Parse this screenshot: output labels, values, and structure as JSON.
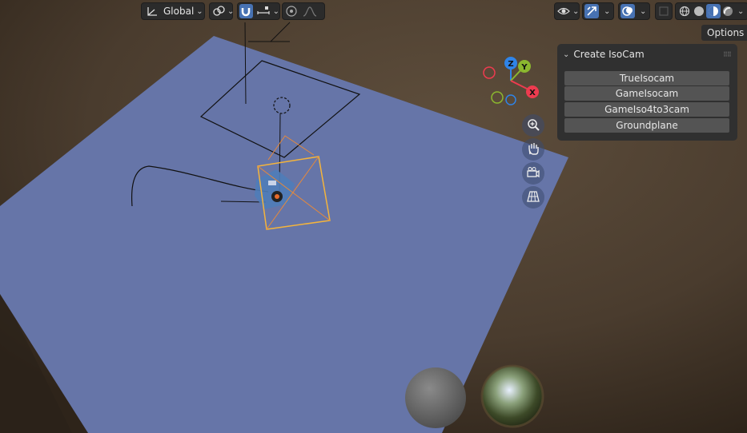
{
  "header": {
    "orientation": {
      "label": "Global"
    },
    "options_label": "Options"
  },
  "panel": {
    "title": "Create IsoCam",
    "buttons": [
      {
        "label": "TrueIsocam"
      },
      {
        "label": "GameIsocam"
      },
      {
        "label": "GameIso4to3cam"
      },
      {
        "label": "Groundplane"
      }
    ]
  },
  "gizmo": {
    "axes": {
      "z": "Z",
      "y": "Y",
      "x": "X"
    },
    "colors": {
      "x": "#ee3b4f",
      "y": "#8bb72f",
      "z": "#2f84e8"
    }
  },
  "nav_icons": [
    "zoom-icon",
    "pan-hand-icon",
    "camera-view-icon",
    "ortho-grid-icon"
  ],
  "shading_modes": [
    "wireframe",
    "solid",
    "material-preview",
    "rendered"
  ],
  "colors": {
    "ground": "#6675a8",
    "background": "#4a3c2e",
    "selected_outline": "#f4b43c",
    "active_shading": "#4772b3"
  }
}
